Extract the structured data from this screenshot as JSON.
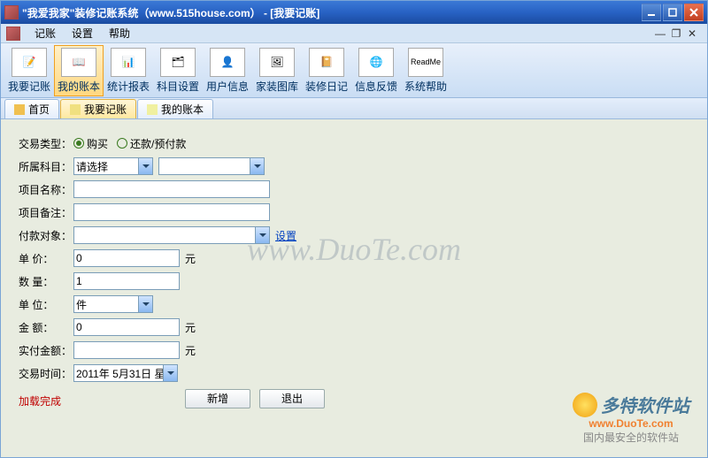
{
  "window": {
    "title": "\"我爱我家\"装修记账系统（www.515house.com） - [我要记账]"
  },
  "menubar": {
    "items": [
      "记账",
      "设置",
      "帮助"
    ]
  },
  "toolbar": {
    "items": [
      {
        "label": "我要记账",
        "active": false
      },
      {
        "label": "我的账本",
        "active": true
      },
      {
        "label": "统计报表",
        "active": false
      },
      {
        "label": "科目设置",
        "active": false
      },
      {
        "label": "用户信息",
        "active": false
      },
      {
        "label": "家装图库",
        "active": false
      },
      {
        "label": "装修日记",
        "active": false
      },
      {
        "label": "信息反馈",
        "active": false
      },
      {
        "label": "系统帮助",
        "active": false
      }
    ]
  },
  "tabs": [
    {
      "label": "首页",
      "active": false
    },
    {
      "label": "我要记账",
      "active": true
    },
    {
      "label": "我的账本",
      "active": false
    }
  ],
  "form": {
    "type_label": "交易类型",
    "type_options": {
      "buy": "购买",
      "refund": "还款/预付款"
    },
    "type_selected": "buy",
    "subject_label": "所属科目",
    "subject_value": "请选择",
    "name_label": "项目名称",
    "name_value": "",
    "remark_label": "项目备注",
    "remark_value": "",
    "payee_label": "付款对象",
    "payee_value": "",
    "payee_link": "设置",
    "price_label": "单    价",
    "price_value": "0",
    "qty_label": "数    量",
    "qty_value": "1",
    "unit_label": "单    位",
    "unit_value": "件",
    "amount_label": "金    额",
    "amount_value": "0",
    "paid_label": "实付金额",
    "paid_value": "",
    "date_label": "交易时间",
    "date_value": "2011年 5月31日 星",
    "currency_unit": "元"
  },
  "status": "加载完成",
  "buttons": {
    "new": "新增",
    "exit": "退出"
  },
  "watermark": "www.DuoTe.com",
  "brand": {
    "name": "多特软件站",
    "site": "www.DuoTe.com",
    "tagline": "国内最安全的软件站"
  }
}
